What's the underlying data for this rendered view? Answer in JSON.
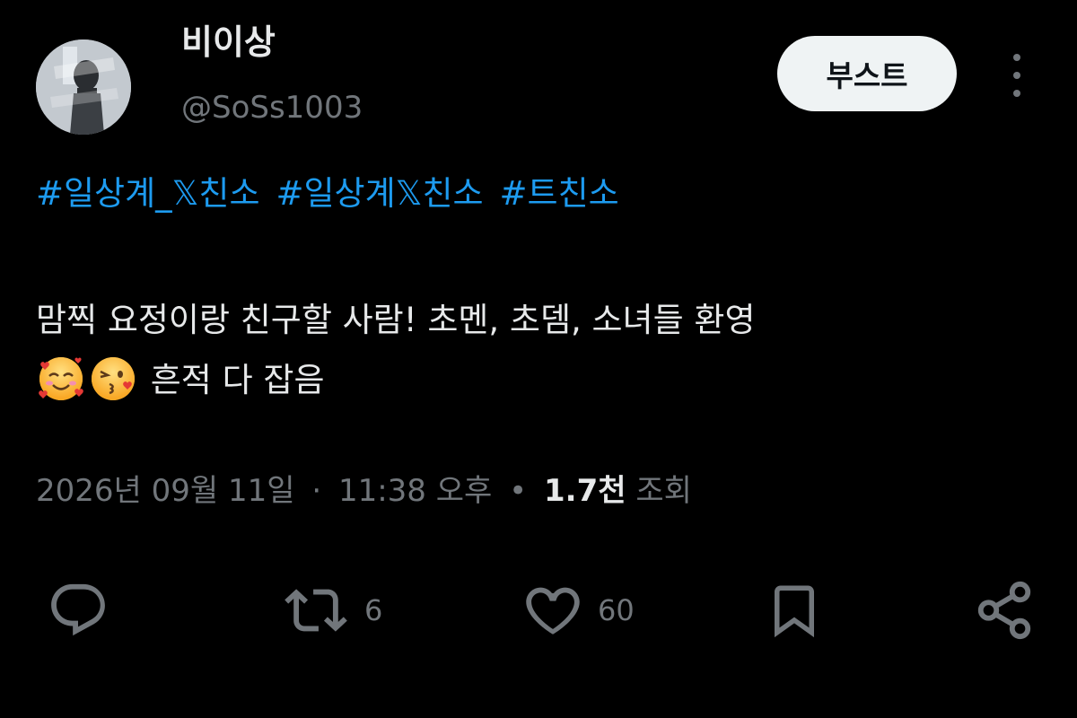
{
  "author": {
    "display_name": "비이상",
    "handle": "@SoSs1003",
    "avatar_icon": "avatar-image"
  },
  "boost_button": {
    "label": "부스트"
  },
  "more_menu_icon": "more-vertical-icon",
  "hashtags": [
    "#일상계_𝕏친소",
    "#일상계𝕏친소",
    "#트친소"
  ],
  "post": {
    "line1": "맘찍 요정이랑 친구할 사람! 초멘, 초뎀, 소녀들 환영",
    "emojis": [
      "smiling-face-with-hearts",
      "face-blowing-a-kiss"
    ],
    "line2_text": "흔적 다 잡음"
  },
  "meta": {
    "date": "2026년 09월 11일",
    "separator": "·",
    "time": "11:38 오후",
    "views_count": "1.7천",
    "views_label": "조회"
  },
  "actions": {
    "reply": {
      "icon": "reply-icon",
      "count": ""
    },
    "repost": {
      "icon": "repost-icon",
      "count": "6"
    },
    "like": {
      "icon": "heart-icon",
      "count": "60"
    },
    "bookmark": {
      "icon": "bookmark-icon",
      "count": ""
    },
    "share": {
      "icon": "share-icon",
      "count": ""
    }
  },
  "colors": {
    "background": "#000000",
    "text_primary": "#e7e9ea",
    "text_secondary": "#71767b",
    "hashtag": "#1d9bf0",
    "button_bg": "#eff3f4",
    "button_text": "#0f1419"
  }
}
